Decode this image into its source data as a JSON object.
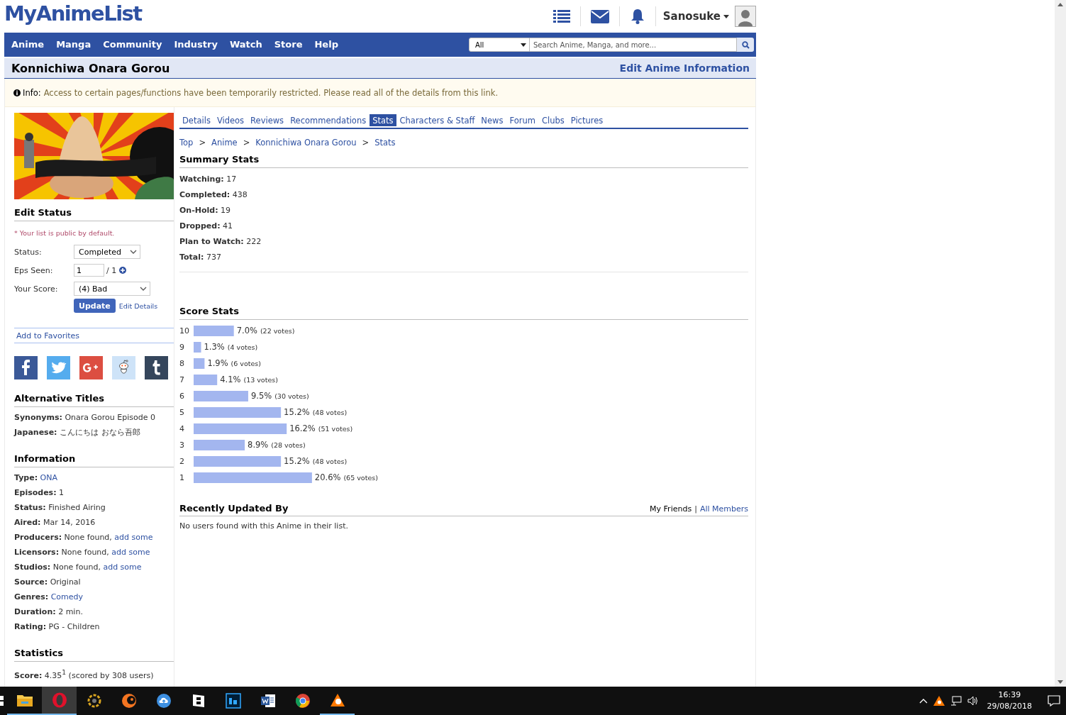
{
  "header": {
    "logo": "MyAnimeList",
    "user": "Sanosuke"
  },
  "nav": {
    "items": [
      "Anime",
      "Manga",
      "Community",
      "Industry",
      "Watch",
      "Store",
      "Help"
    ],
    "search_category": "All",
    "search_placeholder": "Search Anime, Manga, and more..."
  },
  "title_bar": {
    "title": "Konnichiwa Onara Gorou",
    "edit_link": "Edit Anime Information"
  },
  "notice": {
    "label": "Info:",
    "text": "Access to certain pages/functions have been temporarily restricted. Please read all of the details from this link."
  },
  "sidebar": {
    "edit_status": {
      "heading": "Edit Status",
      "note": "* Your list is public by default.",
      "fields": [
        {
          "label": "Status:",
          "kind": "select",
          "value": "Completed"
        },
        {
          "label": "Eps Seen:",
          "kind": "episodes",
          "value": "1",
          "total": "/ 1"
        },
        {
          "label": "Your Score:",
          "kind": "select",
          "value": "(4) Bad"
        }
      ],
      "update_button": "Update",
      "details_link": "Edit Details"
    },
    "favorites_link": "Add to Favorites",
    "sections": [
      {
        "heading": "Alternative Titles",
        "rows": [
          {
            "label": "Synonyms:",
            "value": "Onara Gorou Episode 0"
          },
          {
            "label": "Japanese:",
            "value": "こんにちは おなら吾郎"
          }
        ]
      },
      {
        "heading": "Information",
        "rows": [
          {
            "label": "Type:",
            "link": "ONA"
          },
          {
            "label": "Episodes:",
            "value": "1"
          },
          {
            "label": "Status:",
            "value": "Finished Airing"
          },
          {
            "label": "Aired:",
            "value": "Mar 14, 2016"
          },
          {
            "label": "Producers:",
            "value": "None found,",
            "link": "add some"
          },
          {
            "label": "Licensors:",
            "value": "None found,",
            "link": "add some"
          },
          {
            "label": "Studios:",
            "value": "None found,",
            "link": "add some"
          },
          {
            "label": "Source:",
            "value": "Original"
          },
          {
            "label": "Genres:",
            "link": "Comedy"
          },
          {
            "label": "Duration:",
            "value": "2 min."
          },
          {
            "label": "Rating:",
            "value": "PG - Children"
          }
        ]
      },
      {
        "heading": "Statistics",
        "rows": [
          {
            "label": "Score:",
            "value": "4.35$^{1}$ (scored by 308 users)"
          }
        ]
      }
    ]
  },
  "main": {
    "tabs": [
      {
        "label": "Details",
        "selected": false
      },
      {
        "label": "Videos",
        "selected": false
      },
      {
        "label": "Reviews",
        "selected": false
      },
      {
        "label": "Recommendations",
        "selected": false
      },
      {
        "label": "Stats",
        "selected": true
      },
      {
        "label": "Characters & Staff",
        "selected": false
      },
      {
        "label": "News",
        "selected": false
      },
      {
        "label": "Forum",
        "selected": false
      },
      {
        "label": "Clubs",
        "selected": false
      },
      {
        "label": "Pictures",
        "selected": false
      }
    ],
    "breadcrumb": [
      {
        "kind": "link",
        "text": "Top"
      },
      {
        "kind": "separator",
        "text": ">"
      },
      {
        "kind": "link",
        "text": "Anime"
      },
      {
        "kind": "separator",
        "text": ">"
      },
      {
        "kind": "link",
        "text": "Konnichiwa Onara Gorou"
      },
      {
        "kind": "separator",
        "text": ">"
      },
      {
        "kind": "link",
        "text": "Stats"
      }
    ],
    "summary": {
      "heading": "Summary Stats",
      "rows": [
        {
          "label": "Watching:",
          "value": "17"
        },
        {
          "label": "Completed:",
          "value": "438"
        },
        {
          "label": "On-Hold:",
          "value": "19"
        },
        {
          "label": "Dropped:",
          "value": "41"
        },
        {
          "label": "Plan to Watch:",
          "value": "222"
        },
        {
          "label": "Total:",
          "value": "737"
        }
      ]
    },
    "score": {
      "heading": "Score Stats",
      "chart_data": {
        "type": "bar",
        "orientation": "horizontal",
        "categories": [
          "10",
          "9",
          "8",
          "7",
          "6",
          "5",
          "4",
          "3",
          "2",
          "1"
        ],
        "values": [
          7.0,
          1.3,
          1.9,
          4.1,
          9.5,
          15.2,
          16.2,
          8.9,
          15.2,
          20.6
        ],
        "value_labels": [
          "7.0%",
          "1.3%",
          "1.9%",
          "4.1%",
          "9.5%",
          "15.2%",
          "16.2%",
          "8.9%",
          "15.2%",
          "20.6%"
        ],
        "annotations": [
          "(22 votes)",
          "(4 votes)",
          "(6 votes)",
          "(13 votes)",
          "(30 votes)",
          "(48 votes)",
          "(51 votes)",
          "(28 votes)",
          "(48 votes)",
          "(65 votes)"
        ]
      }
    },
    "recent": {
      "heading": "Recently Updated By",
      "filters": [
        {
          "label": "My Friends",
          "selected": true
        },
        {
          "label": "All Members",
          "selected": false
        }
      ],
      "separator": "|",
      "empty": "No users found with this Anime in their list."
    }
  },
  "taskbar": {
    "time": "16:39",
    "date": "29/08/2018"
  }
}
